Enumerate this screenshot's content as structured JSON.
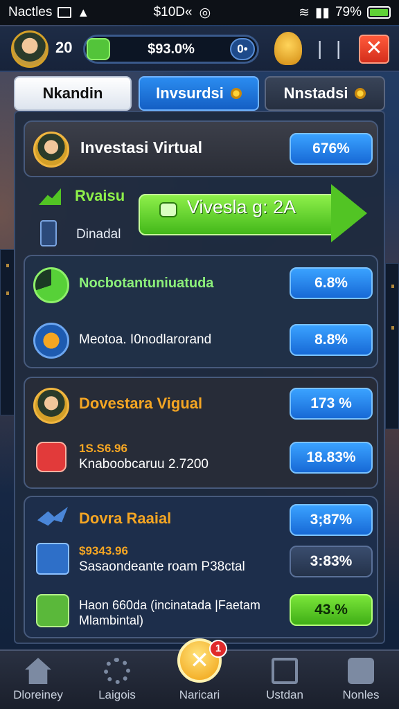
{
  "status_bar": {
    "left_text": "Nactles",
    "center_text": "$10D«",
    "battery": "79%"
  },
  "hud": {
    "level": "20",
    "progress_text": "$93.0%",
    "progress_plus": "0•"
  },
  "tabs": [
    {
      "label": "Nkandin"
    },
    {
      "label": "Invsurdsi"
    },
    {
      "label": "Nnstadsi"
    }
  ],
  "panel": {
    "card1": {
      "title": "Investasi Virtual",
      "value": "676%"
    },
    "rvaisu": "Rvaisu",
    "dinadal": "Dinadal",
    "invest_button": "Vivesla g: 2A",
    "card2": {
      "row1": {
        "title": "Nocbotantuniuatuda",
        "value": "6.8%"
      },
      "row2": {
        "title": "Meotoa. I0nodlarorand",
        "value": "8.8%"
      }
    },
    "card3": {
      "row1": {
        "title": "Dovestara Vigual",
        "value": "173 %"
      },
      "row2": {
        "amount": "1S.S6.96",
        "title": "Knaboobcaruu 2.7200",
        "value": "18.83%"
      }
    },
    "card4": {
      "row1": {
        "title": "Dovra Raaial",
        "value": "3;87%"
      },
      "row2": {
        "amount": "$9343.96",
        "title": "Sasaondeante roam P38ctal",
        "value": "3:83%"
      },
      "row3": {
        "title_line1": "Haon 660da (incinatada |Faetam",
        "title_line2": "Mlambintal)",
        "value": "43.%"
      }
    }
  },
  "bottom_nav": [
    {
      "label": "Dloreiney"
    },
    {
      "label": "Laigois"
    },
    {
      "label": "Naricari"
    },
    {
      "label": "Ustdan"
    },
    {
      "label": "Nonles"
    }
  ],
  "center_badge": "1",
  "colors": {
    "accent_blue": "#1769d6",
    "accent_green": "#43b81a",
    "gold": "#f5a623",
    "danger": "#d42e1c"
  }
}
